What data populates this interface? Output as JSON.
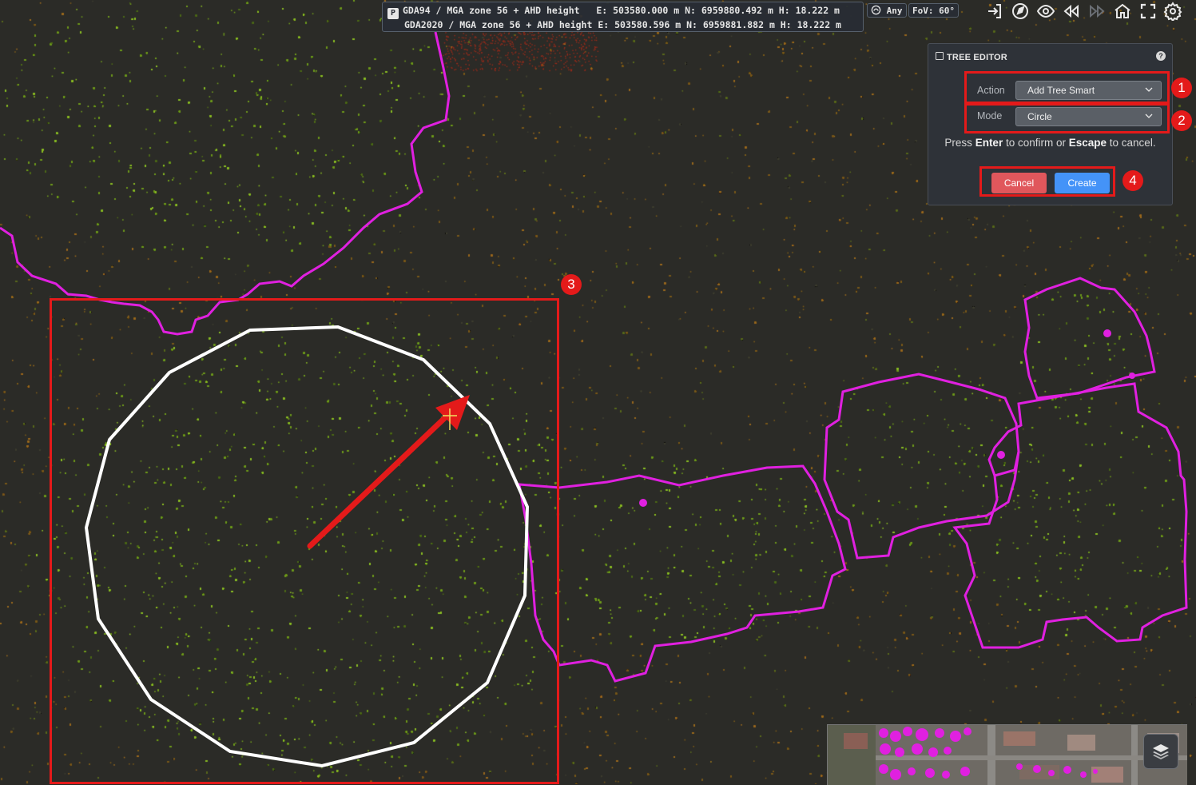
{
  "coordinates": {
    "row1": "GDA94 / MGA zone 56 + AHD height   E: 503580.000 m N: 6959880.492 m H: 18.222 m",
    "row2": "GDA2020 / MGA zone 56 + AHD height E: 503580.596 m N: 6959881.882 m H: 18.222 m",
    "crs_icon": "P"
  },
  "snap": {
    "label": "Any",
    "icon": "snap-icon"
  },
  "fov": {
    "label": "FoV: 60°"
  },
  "toolbar": {
    "icons": [
      "sign-in-icon",
      "compass-icon",
      "eye-icon",
      "rewind-icon",
      "forward-icon",
      "home-icon",
      "fullscreen-icon",
      "gear-icon"
    ]
  },
  "tree_editor": {
    "title": "TREE EDITOR",
    "help": "?",
    "action_label": "Action",
    "action_value": "Add Tree Smart",
    "mode_label": "Mode",
    "mode_value": "Circle",
    "instruction_prefix": "Press ",
    "instruction_key1": "Enter",
    "instruction_middle": " to confirm or ",
    "instruction_key2": "Escape",
    "instruction_suffix": " to cancel.",
    "cancel_label": "Cancel",
    "create_label": "Create"
  },
  "annotations": {
    "badge_1": "1",
    "badge_2": "2",
    "badge_3": "3",
    "badge_4": "4"
  },
  "colors": {
    "highlight": "#e41a1a",
    "polygon": "#e020e0",
    "circle": "#ffffff",
    "create_button": "#4493f8",
    "cancel_button": "#e0575c"
  }
}
